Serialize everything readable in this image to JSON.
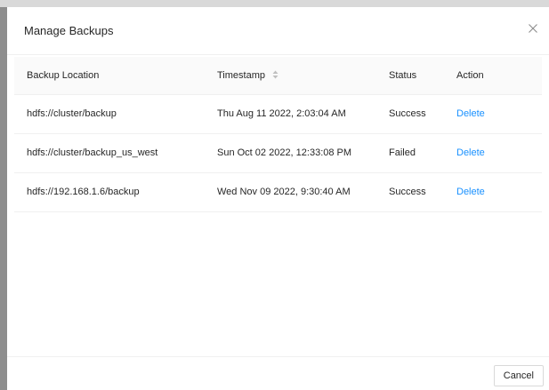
{
  "modal": {
    "title": "Manage Backups",
    "cancel_label": "Cancel"
  },
  "table": {
    "headers": {
      "location": "Backup Location",
      "timestamp": "Timestamp",
      "status": "Status",
      "action": "Action"
    },
    "rows": [
      {
        "location": "hdfs://cluster/backup",
        "timestamp": "Thu Aug 11 2022, 2:03:04 AM",
        "status": "Success",
        "action": "Delete"
      },
      {
        "location": "hdfs://cluster/backup_us_west",
        "timestamp": "Sun Oct 02 2022, 12:33:08 PM",
        "status": "Failed",
        "action": "Delete"
      },
      {
        "location": "hdfs://192.168.1.6/backup",
        "timestamp": "Wed Nov 09 2022, 9:30:40 AM",
        "status": "Success",
        "action": "Delete"
      }
    ]
  },
  "colors": {
    "link": "#1890ff",
    "header_bg": "#fafafa",
    "backdrop": "#8e8e8e"
  },
  "icons": {
    "close": "close-icon",
    "sort": "sort-icon"
  }
}
